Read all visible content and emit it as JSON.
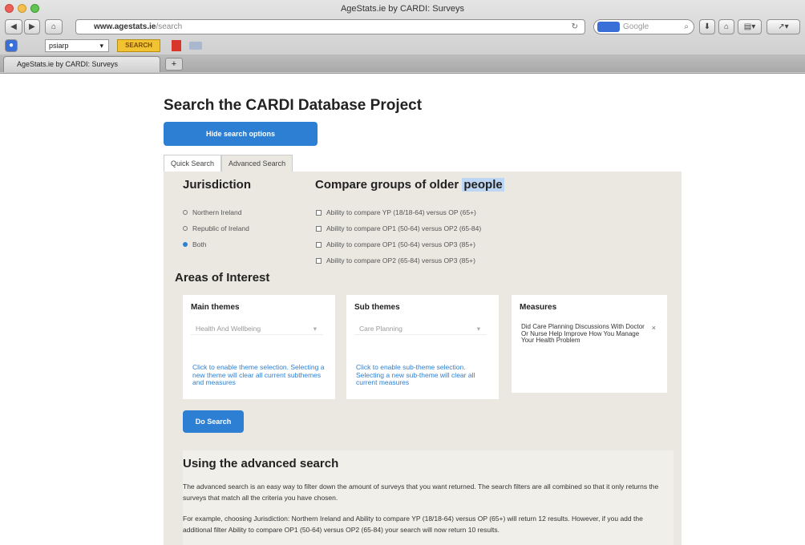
{
  "browser": {
    "window_title": "AgeStats.ie by CARDI: Surveys",
    "url_domain": "www.agestats.ie",
    "url_path": "/search",
    "search_placeholder": "Google",
    "bookmark_select_value": "psiarp",
    "bookmark_search_label": "SEARCH",
    "tab_title": "AgeStats.ie by CARDI: Surveys",
    "new_tab": "+"
  },
  "page": {
    "title": "Search the CARDI Database Project",
    "hide_button": "Hide search options",
    "tabs": [
      "Quick Search",
      "Advanced Search"
    ],
    "jurisdiction": {
      "heading": "Jurisdiction",
      "options": [
        "Northern Ireland",
        "Republic of Ireland",
        "Both"
      ],
      "selected": "Both"
    },
    "compare": {
      "heading_pre": "Compare groups of older ",
      "heading_highlight": "people",
      "options": [
        "Ability to compare YP (18/18-64) versus OP (65+)",
        "Ability to compare OP1 (50-64) versus OP2 (65-84)",
        "Ability to compare OP1 (50-64) versus OP3 (85+)",
        "Ability to compare OP2 (65-84) versus OP3 (85+)"
      ]
    },
    "areas": {
      "heading": "Areas of Interest",
      "main": {
        "heading": "Main themes",
        "value": "Health And Wellbeing",
        "note": "Click to enable theme selection. Selecting a new theme will clear all current subthemes and measures"
      },
      "sub": {
        "heading": "Sub themes",
        "value": "Care Planning",
        "note": "Click to enable sub-theme selection. Selecting a new sub-theme will clear all current measures"
      },
      "measures": {
        "heading": "Measures",
        "value": "Did Care Planning Discussions With Doctor Or Nurse Help Improve How You Manage Your Health Problem",
        "remove": "×"
      }
    },
    "do_search": "Do Search",
    "advanced": {
      "heading": "Using the advanced search",
      "p1": "The advanced search is an easy way to filter down the amount of surveys that you want returned. The search filters are all combined so that it only returns the surveys that match all the criteria you have chosen.",
      "p2": "For example, choosing Jurisdiction: Northern Ireland and Ability to compare YP (18/18-64) versus OP (65+) will return 12 results. However, if you add the additional filter Ability to compare OP1 (50-64) versus OP2 (65-84) your search will now return 10 results."
    }
  },
  "colors": {
    "accent": "#2d7fd3",
    "panel_bg": "#eae8e1",
    "highlight": "#bcd6f4"
  }
}
